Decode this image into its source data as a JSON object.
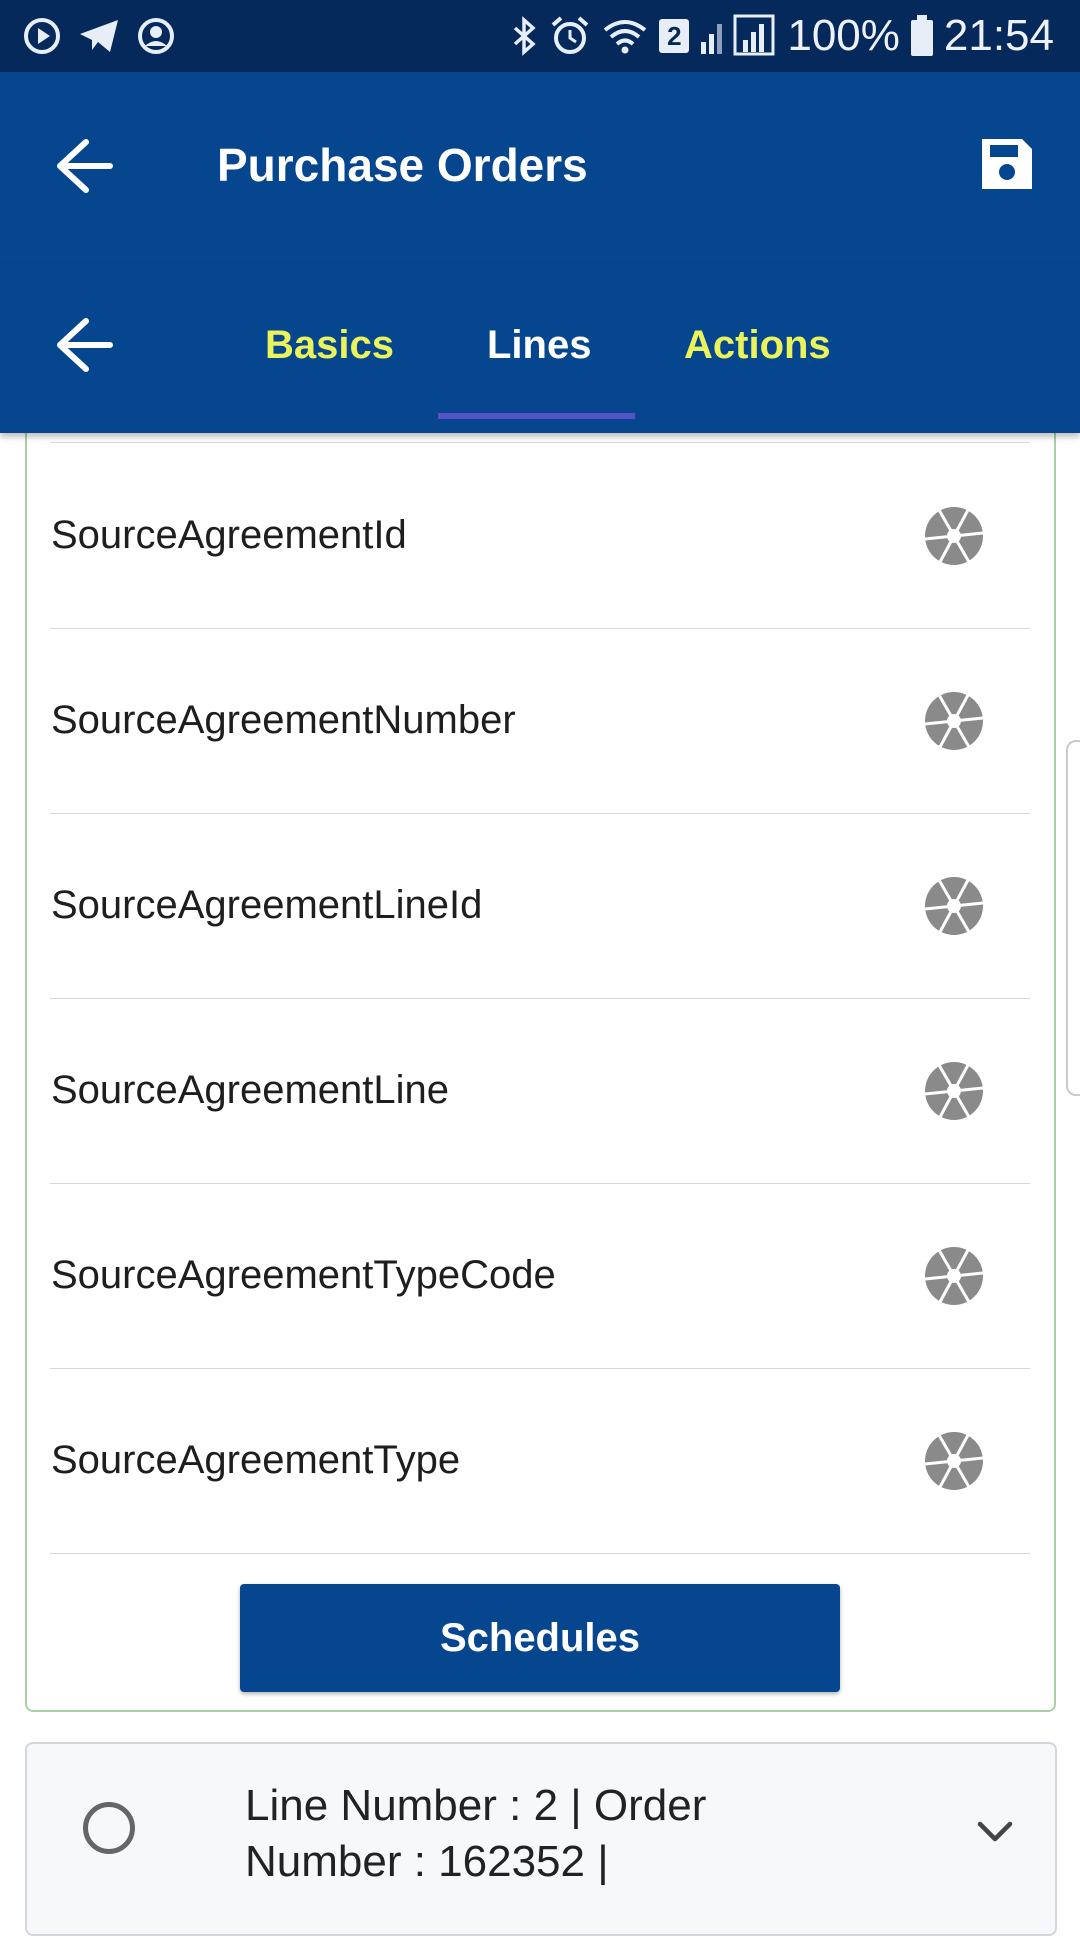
{
  "status_bar": {
    "battery_text": "100%",
    "time": "21:54",
    "sim_badge": "2",
    "icons": [
      "play-circle-icon",
      "telegram-icon",
      "account-circle-icon",
      "bluetooth-icon",
      "alarm-icon",
      "wifi-icon",
      "signal-icon",
      "battery-icon"
    ]
  },
  "app_bar": {
    "title": "Purchase Orders",
    "icons": [
      "back-arrow-icon",
      "save-icon"
    ]
  },
  "tabs": [
    {
      "label": "Basics",
      "color": "#ebf35a"
    },
    {
      "label": "Lines",
      "color": "#ffffff",
      "selected": true
    },
    {
      "label": "Actions",
      "color": "#ebf35a"
    }
  ],
  "fields": [
    {
      "label": "SourceAgreementId"
    },
    {
      "label": "SourceAgreementNumber"
    },
    {
      "label": "SourceAgreementLineId"
    },
    {
      "label": "SourceAgreementLine"
    },
    {
      "label": "SourceAgreementTypeCode"
    },
    {
      "label": "SourceAgreementType"
    }
  ],
  "field_icon": "shutter-icon",
  "schedules_button": "Schedules",
  "line_item": {
    "text": "Line Number : 2 | Order Number : 162352 |"
  },
  "colors": {
    "primary": "#06468f",
    "status_bar": "#06295c",
    "tab_accent": "#ebf35a",
    "indicator": "#5653c4",
    "card_border": "#a9cfa6"
  }
}
